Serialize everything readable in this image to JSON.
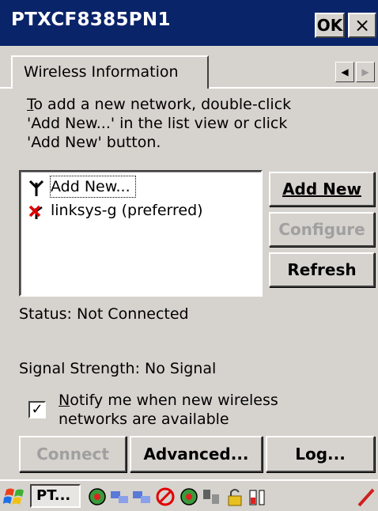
{
  "window": {
    "title": "PTXCF8385PN1",
    "ok_label": "OK",
    "close_label": "×"
  },
  "tabs": {
    "active_label": "Wireless Information"
  },
  "instructions": {
    "text_rest": "o add a new network, double-click\n'Add New...' in the list view or click\n'Add New' button.",
    "first_letter": "T"
  },
  "networks": [
    {
      "label": "Add New...",
      "icon": "antenna-icon"
    },
    {
      "label": "linksys-g (preferred)",
      "icon": "disconnected-network-icon"
    }
  ],
  "buttons": {
    "add_new": "Add New",
    "configure": "Configure",
    "refresh": "Refresh",
    "connect": "Connect",
    "advanced": "Advanced...",
    "log": "Log..."
  },
  "status": {
    "text": "Status:  Not Connected"
  },
  "signal": {
    "text": "Signal Strength:  No Signal"
  },
  "notify": {
    "first_letter": "N",
    "text_rest": "otify me when new wireless\nnetworks are available",
    "checked": true
  },
  "taskbar": {
    "task_label": "PT..."
  },
  "colors": {
    "titlebar": "#0a246a",
    "face": "#d6d3ce"
  }
}
